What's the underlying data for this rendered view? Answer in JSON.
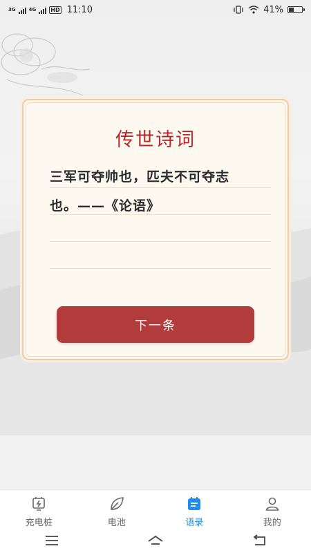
{
  "status_bar": {
    "network_1": "3G",
    "network_2": "4G",
    "hd": "HD",
    "time": "11:10",
    "battery_percent_text": "41%",
    "battery_level": 0.41
  },
  "card": {
    "title": "传世诗词",
    "quote_line_1": "三军可夺帅也，匹夫不可夺志",
    "quote_line_2": "也。——《论语》",
    "next_button_label": "下一条"
  },
  "tabs": [
    {
      "label": "充电桩",
      "icon": "charging-station-icon",
      "active": false
    },
    {
      "label": "电池",
      "icon": "leaf-icon",
      "active": false
    },
    {
      "label": "语录",
      "icon": "calendar-icon",
      "active": true
    },
    {
      "label": "我的",
      "icon": "person-icon",
      "active": false
    }
  ],
  "colors": {
    "accent": "#1f8cef",
    "title_red": "#b9262a",
    "button_red": "#b23b3c"
  }
}
